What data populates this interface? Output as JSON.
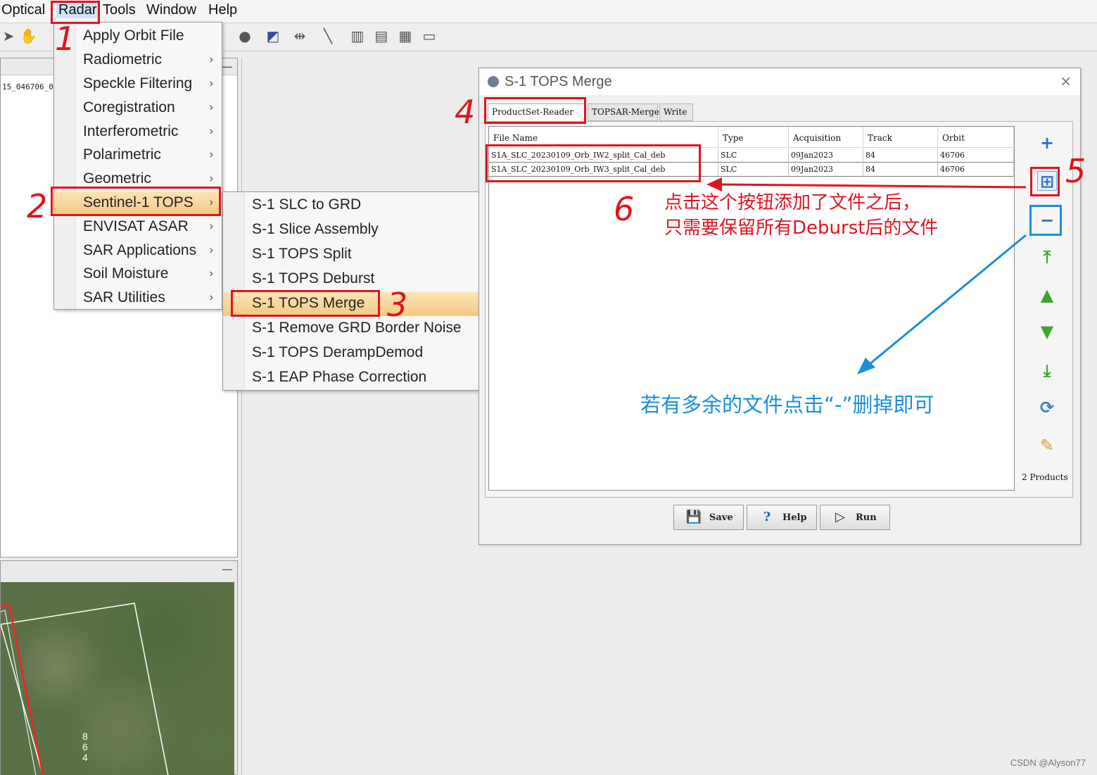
{
  "menubar": [
    "Optical",
    "Radar",
    "Tools",
    "Window",
    "Help"
  ],
  "product_label": "15_046706_0",
  "radar_menu": [
    {
      "label": "Apply Orbit File",
      "sub": false
    },
    {
      "label": "Radiometric",
      "sub": true
    },
    {
      "label": "Speckle Filtering",
      "sub": true
    },
    {
      "label": "Coregistration",
      "sub": true
    },
    {
      "label": "Interferometric",
      "sub": true
    },
    {
      "label": "Polarimetric",
      "sub": true
    },
    {
      "label": "Geometric",
      "sub": true
    },
    {
      "label": "Sentinel-1 TOPS",
      "sub": true
    },
    {
      "label": "ENVISAT ASAR",
      "sub": true
    },
    {
      "label": "SAR Applications",
      "sub": true
    },
    {
      "label": "Soil Moisture",
      "sub": true
    },
    {
      "label": "SAR Utilities",
      "sub": true
    }
  ],
  "submenu_arrow": "›",
  "s1_submenu": [
    "S-1 SLC to GRD",
    "S-1 Slice Assembly",
    "S-1 TOPS Split",
    "S-1 TOPS Deburst",
    "S-1 TOPS Merge",
    "S-1 Remove GRD Border Noise",
    "S-1 TOPS DerampDemod",
    "S-1 EAP Phase Correction"
  ],
  "dialog": {
    "title": "S-1 TOPS Merge",
    "close": "×",
    "tabs": [
      "ProductSet-Reader",
      "TOPSAR-Merge",
      "Write"
    ],
    "columns": [
      "File Name",
      "Type",
      "Acquisition",
      "Track",
      "Orbit"
    ],
    "rows": [
      [
        "S1A_SLC_20230109_Orb_IW2_split_Cal_deb",
        "SLC",
        "09Jan2023",
        "84",
        "46706"
      ],
      [
        "S1A_SLC_20230109_Orb_IW3_split_Cal_deb",
        "SLC",
        "09Jan2023",
        "84",
        "46706"
      ]
    ],
    "product_count": "2 Products",
    "buttons": {
      "save": "Save",
      "help": "Help",
      "run": "Run"
    }
  },
  "annotations": {
    "n1": "1",
    "n2": "2",
    "n3": "3",
    "n4": "4",
    "n5": "5",
    "n6": "6",
    "red_note_line1": "点击这个按钮添加了文件之后，",
    "red_note_line2": "只需要保留所有Deburst后的文件",
    "blue_note": "若有多余的文件点击“-”删掉即可"
  },
  "map_text": [
    "8",
    "6",
    "4"
  ],
  "watermark": "CSDN @Alyson77",
  "colors": {
    "annotation_red": "#e0141f",
    "annotation_blue": "#1a8fd6",
    "menu_highlight": "#f3c983",
    "add_icon": "#2f6fd1",
    "move_icon": "#3fa52e"
  }
}
